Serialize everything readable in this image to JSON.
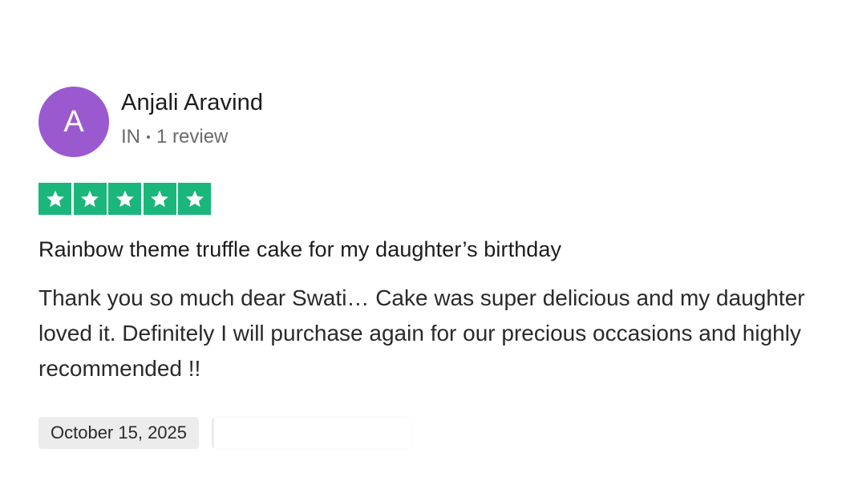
{
  "reviewer": {
    "avatar_initial": "A",
    "avatar_color": "#9b59d0",
    "name": "Anjali Aravind",
    "country": "IN",
    "review_count": "1 review"
  },
  "rating": {
    "stars": 5,
    "max_stars": 5,
    "star_color": "#1ab67b",
    "icon": "star-icon"
  },
  "review": {
    "title": "Rainbow theme truffle cake for my daughter’s birthday",
    "body": "Thank you so much dear Swati… Cake was super delicious and my daughter loved it. Definitely I will purchase again for our precious occasions and highly recommended !!",
    "date": "October 15, 2025"
  }
}
